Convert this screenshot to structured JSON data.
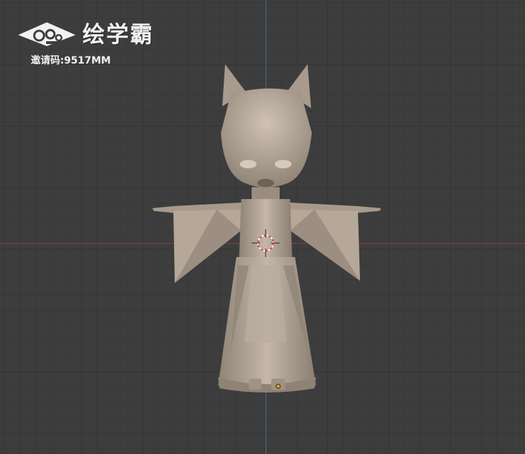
{
  "brand": {
    "name": "绘学霸",
    "invite_code": "邀请码:9517MM"
  },
  "viewport": {
    "background": "#3d3d3d",
    "x_axis_color": "#8a3b45",
    "y_axis_color": "#4a6796"
  },
  "scene": {
    "model_color": "#b3a597",
    "origin_marker_color": "#e8a020"
  }
}
